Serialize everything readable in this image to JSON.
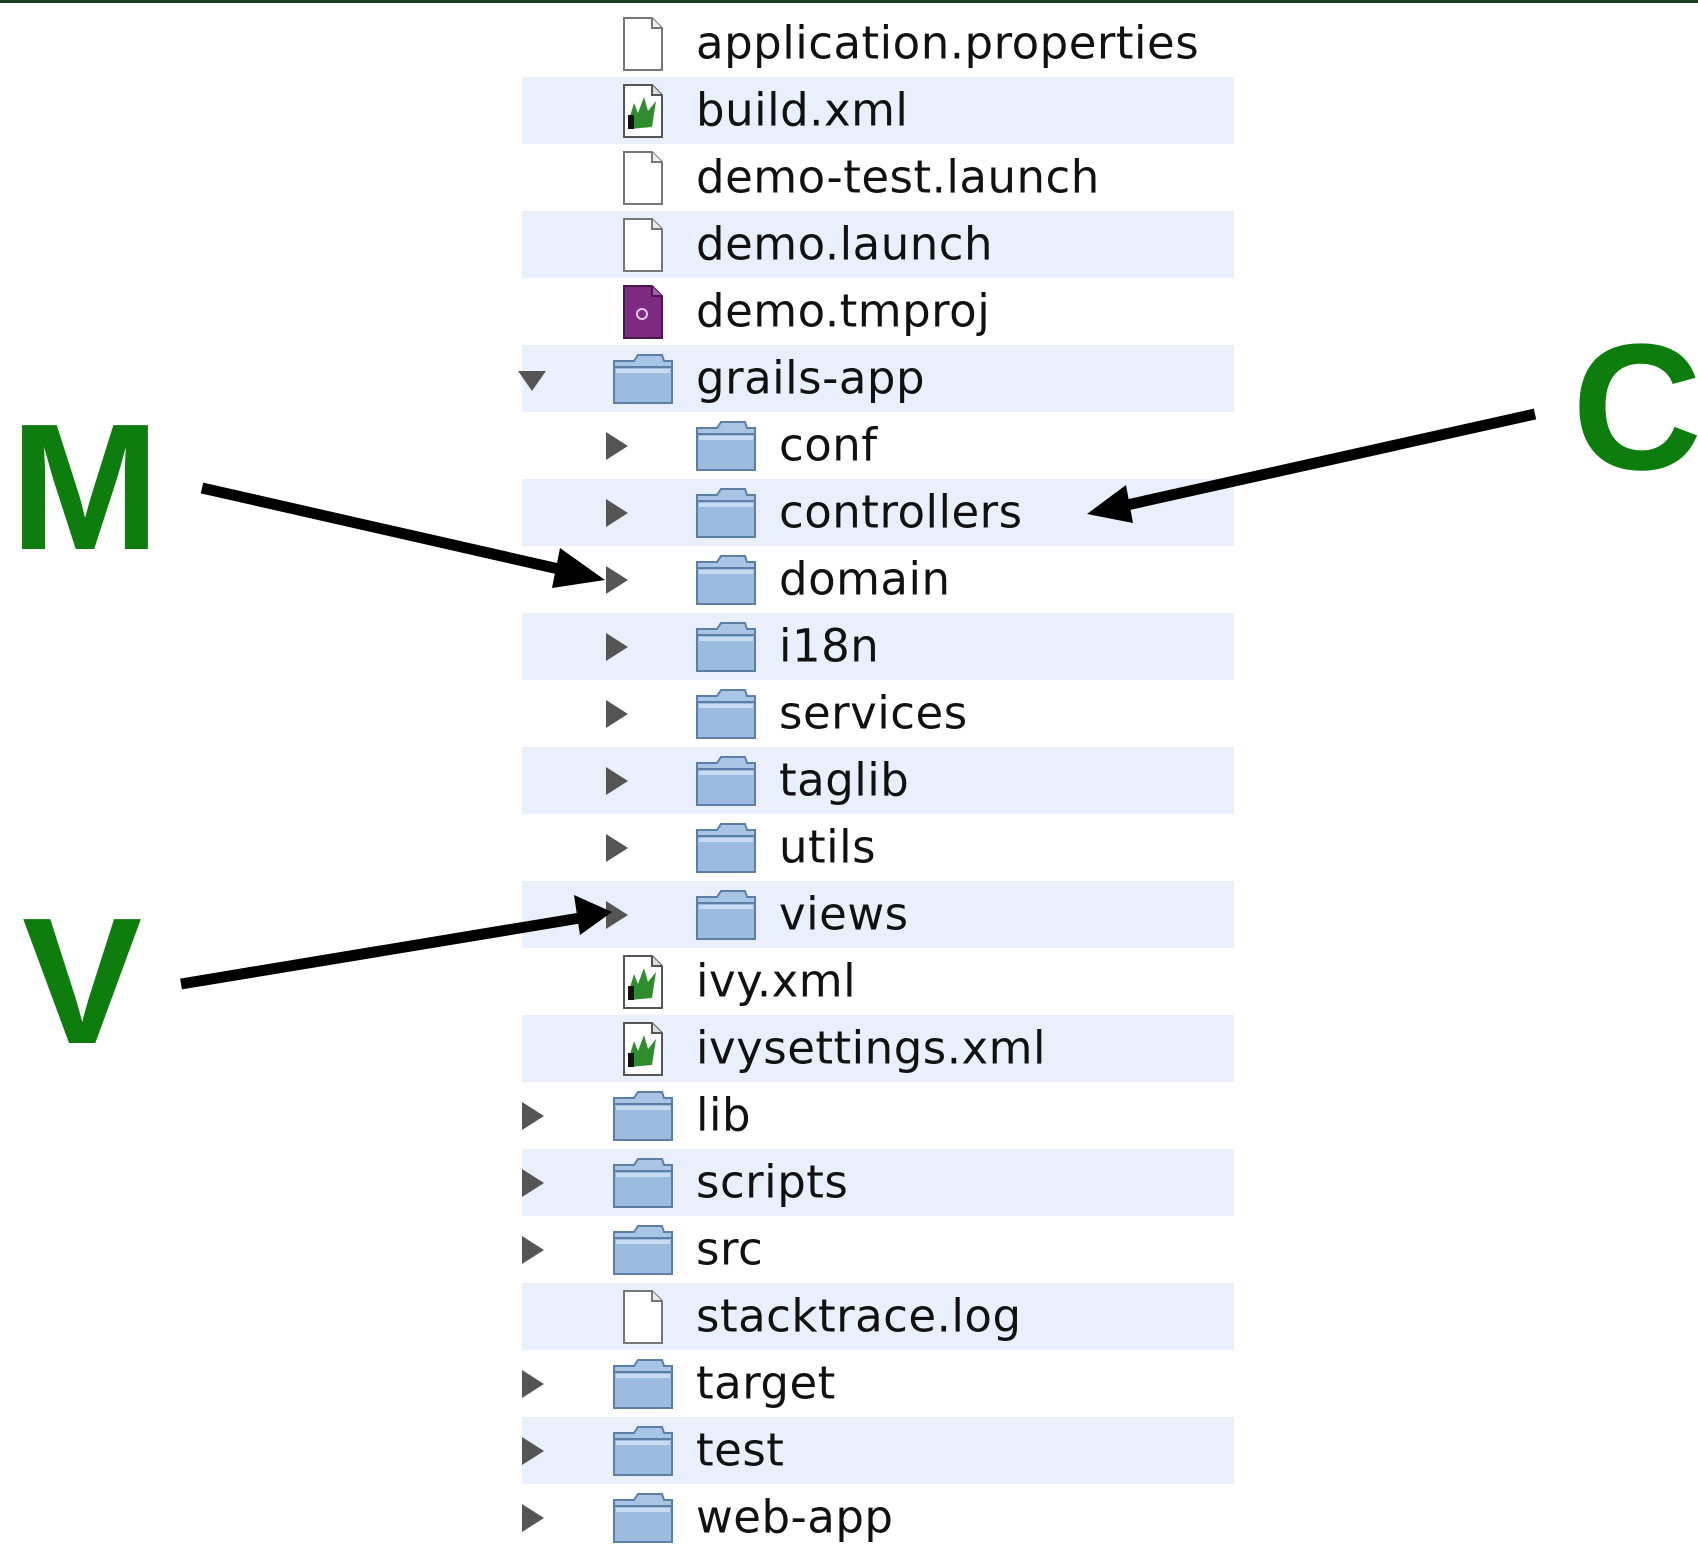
{
  "callouts": {
    "m": "M",
    "v": "V",
    "c": "C"
  },
  "colors": {
    "callout": "#0d7d0d",
    "row_alt": "#eaf0fb",
    "folder": "#9bbbe0",
    "xml_badge": "#2f8c2f",
    "tmproj": "#7d2a82"
  },
  "tree": [
    {
      "label": "application.properties",
      "icon": "file-icon",
      "depth": 1,
      "toggle": null
    },
    {
      "label": "build.xml",
      "icon": "xml-file-icon",
      "depth": 1,
      "toggle": null
    },
    {
      "label": "demo-test.launch",
      "icon": "file-icon",
      "depth": 1,
      "toggle": null
    },
    {
      "label": "demo.launch",
      "icon": "file-icon",
      "depth": 1,
      "toggle": null
    },
    {
      "label": "demo.tmproj",
      "icon": "tmproj-file-icon",
      "depth": 1,
      "toggle": null
    },
    {
      "label": "grails-app",
      "icon": "folder-icon",
      "depth": 1,
      "toggle": "expanded"
    },
    {
      "label": "conf",
      "icon": "folder-icon",
      "depth": 2,
      "toggle": "collapsed"
    },
    {
      "label": "controllers",
      "icon": "folder-icon",
      "depth": 2,
      "toggle": "collapsed"
    },
    {
      "label": "domain",
      "icon": "folder-icon",
      "depth": 2,
      "toggle": "collapsed"
    },
    {
      "label": "i18n",
      "icon": "folder-icon",
      "depth": 2,
      "toggle": "collapsed"
    },
    {
      "label": "services",
      "icon": "folder-icon",
      "depth": 2,
      "toggle": "collapsed"
    },
    {
      "label": "taglib",
      "icon": "folder-icon",
      "depth": 2,
      "toggle": "collapsed"
    },
    {
      "label": "utils",
      "icon": "folder-icon",
      "depth": 2,
      "toggle": "collapsed"
    },
    {
      "label": "views",
      "icon": "folder-icon",
      "depth": 2,
      "toggle": "collapsed"
    },
    {
      "label": "ivy.xml",
      "icon": "xml-file-icon",
      "depth": 1,
      "toggle": null
    },
    {
      "label": "ivysettings.xml",
      "icon": "xml-file-icon",
      "depth": 1,
      "toggle": null
    },
    {
      "label": "lib",
      "icon": "folder-icon",
      "depth": 1,
      "toggle": "collapsed"
    },
    {
      "label": "scripts",
      "icon": "folder-icon",
      "depth": 1,
      "toggle": "collapsed"
    },
    {
      "label": "src",
      "icon": "folder-icon",
      "depth": 1,
      "toggle": "collapsed"
    },
    {
      "label": "stacktrace.log",
      "icon": "file-icon",
      "depth": 1,
      "toggle": null
    },
    {
      "label": "target",
      "icon": "folder-icon",
      "depth": 1,
      "toggle": "collapsed"
    },
    {
      "label": "test",
      "icon": "folder-icon",
      "depth": 1,
      "toggle": "collapsed"
    },
    {
      "label": "web-app",
      "icon": "folder-icon",
      "depth": 1,
      "toggle": "collapsed"
    }
  ]
}
